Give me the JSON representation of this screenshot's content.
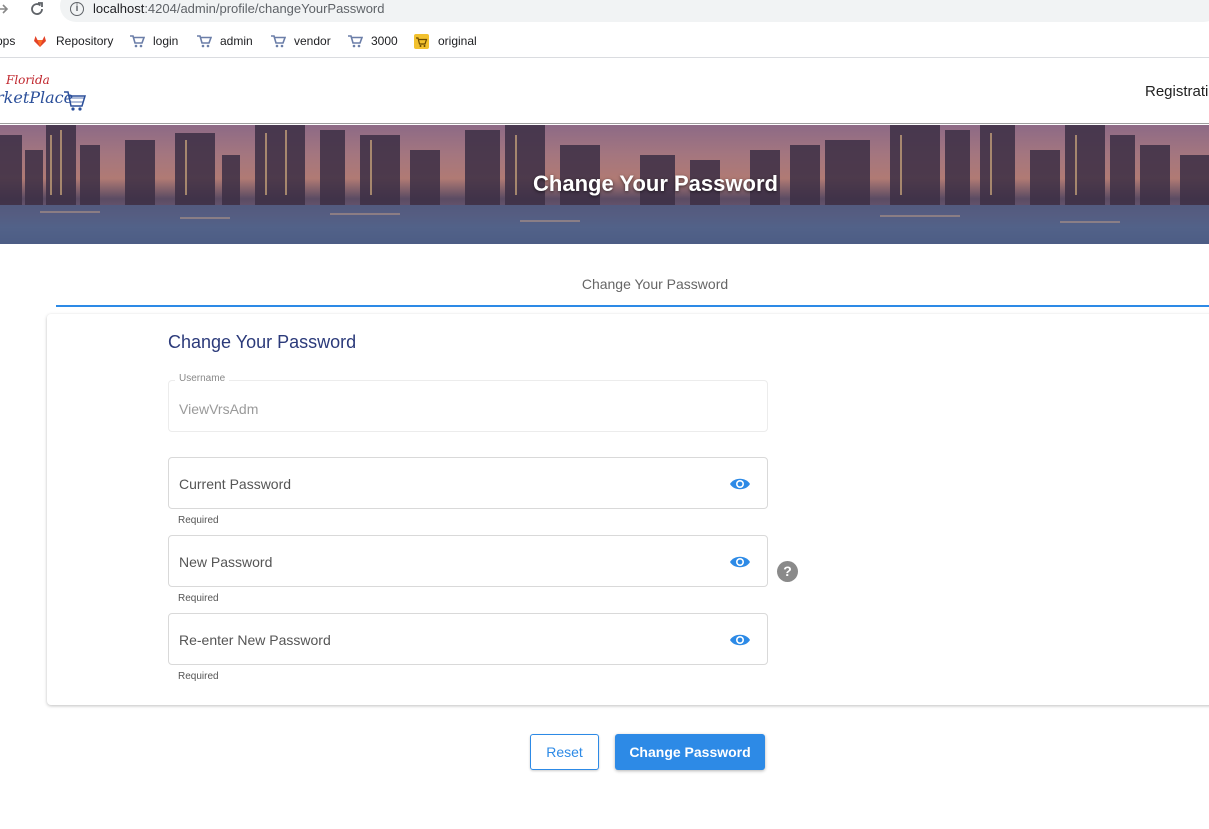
{
  "browser": {
    "url_host": "localhost",
    "url_rest": ":4204/admin/profile/changeYourPassword"
  },
  "bookmarks": [
    {
      "label": "pps",
      "icon": "apps-icon"
    },
    {
      "label": "Repository",
      "icon": "gitlab-icon"
    },
    {
      "label": "login",
      "icon": "cart-icon"
    },
    {
      "label": "admin",
      "icon": "cart-icon"
    },
    {
      "label": "vendor",
      "icon": "cart-icon"
    },
    {
      "label": "3000",
      "icon": "cart-icon"
    },
    {
      "label": "original",
      "icon": "yellow-cart-icon"
    }
  ],
  "header": {
    "logo_line1": "Florida",
    "logo_line2": "rketPlace",
    "nav_registration": "Registratic"
  },
  "banner": {
    "title": "Change Your Password"
  },
  "tabs": [
    {
      "label": "Change Your Password",
      "active": true
    }
  ],
  "form": {
    "title": "Change Your Password",
    "username": {
      "label": "Username",
      "value": "ViewVrsAdm"
    },
    "current_password": {
      "placeholder": "Current Password",
      "hint": "Required"
    },
    "new_password": {
      "placeholder": "New Password",
      "hint": "Required"
    },
    "confirm_password": {
      "placeholder": "Re-enter New Password",
      "hint": "Required"
    },
    "help_glyph": "?"
  },
  "actions": {
    "reset": "Reset",
    "change": "Change Password"
  },
  "colors": {
    "accent": "#2d8ae6",
    "title": "#2b3a7a"
  }
}
